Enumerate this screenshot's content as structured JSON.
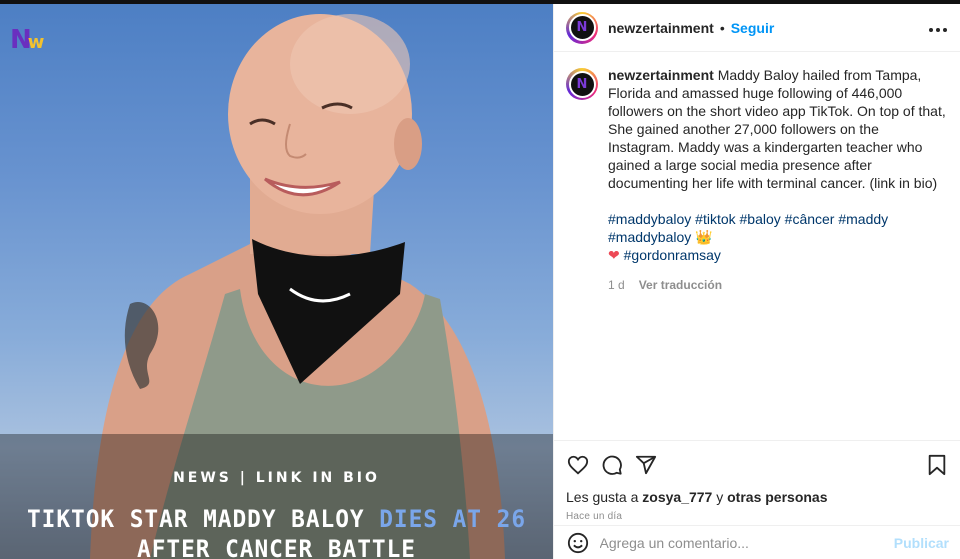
{
  "media": {
    "logo": "N",
    "logo_accent": "w",
    "news_line": "NEWS | LINK IN BIO",
    "headline_part1": "TIKTOK STAR MADDY BALOY ",
    "headline_accent": "DIES AT 26",
    "headline_line2": "AFTER CANCER BATTLE"
  },
  "header": {
    "username": "newzertainment",
    "separator": "•",
    "follow_label": "Seguir",
    "more_icon": "more-horizontal-icon"
  },
  "caption": {
    "username": "newzertainment",
    "text": "Maddy Baloy hailed from Tampa, Florida and amassed huge following of 446,000 followers on the short video app TikTok. On top of that, She gained another 27,000 followers on the Instagram. Maddy was a kindergarten teacher who gained a large social media presence after documenting her life with terminal cancer. (link in bio)",
    "hashtags": "#maddybaloy #tiktok #baloy #câncer #maddy #maddybaloy 👑",
    "heart": "❤",
    "hashtags2": "#gordonramsay",
    "time": "1 d",
    "translate": "Ver traducción"
  },
  "actions": {
    "likes_prefix": "Les gusta a ",
    "likes_user": "zosya_777",
    "likes_middle": " y ",
    "likes_others": "otras personas",
    "time_ago": "Hace un día"
  },
  "comment": {
    "placeholder": "Agrega un comentario...",
    "publish": "Publicar"
  },
  "colors": {
    "accent": "#0095f6",
    "heart": "#ed4956",
    "headline_accent": "#7aa6ea"
  }
}
